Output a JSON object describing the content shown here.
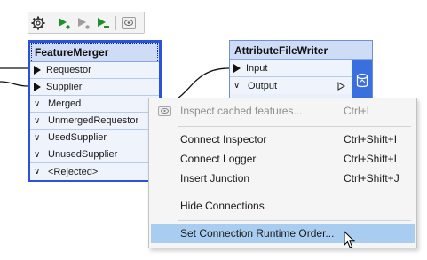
{
  "toolbar": {
    "buttons": [
      "gear-icon",
      "run-to-this-icon",
      "run-from-this-icon",
      "run-just-this-icon",
      "inspect-cache-icon"
    ]
  },
  "feature_merger": {
    "title": "FeatureMerger",
    "inputs": [
      "Requestor",
      "Supplier"
    ],
    "outputs": [
      "Merged",
      "UnmergedRequestor",
      "UsedSupplier",
      "UnusedSupplier",
      "<Rejected>"
    ]
  },
  "attribute_file_writer": {
    "title": "AttributeFileWriter",
    "input": "Input",
    "output": "Output"
  },
  "context_menu": {
    "items": [
      {
        "label": "Inspect cached features...",
        "shortcut": "Ctrl+I",
        "disabled": true
      },
      {
        "label": "Connect Inspector",
        "shortcut": "Ctrl+Shift+I"
      },
      {
        "label": "Connect Logger",
        "shortcut": "Ctrl+Shift+L"
      },
      {
        "label": "Insert Junction",
        "shortcut": "Ctrl+Shift+J"
      },
      {
        "label": "Hide Connections",
        "shortcut": ""
      },
      {
        "label": "Set Connection Runtime Order...",
        "shortcut": "",
        "highlighted": true
      }
    ]
  },
  "colors": {
    "node_border_selected": "#2a53d9",
    "node_header": "#cfdcf6",
    "menu_highlight": "#a9cdf0",
    "writer_badge": "#3a6fe0"
  }
}
